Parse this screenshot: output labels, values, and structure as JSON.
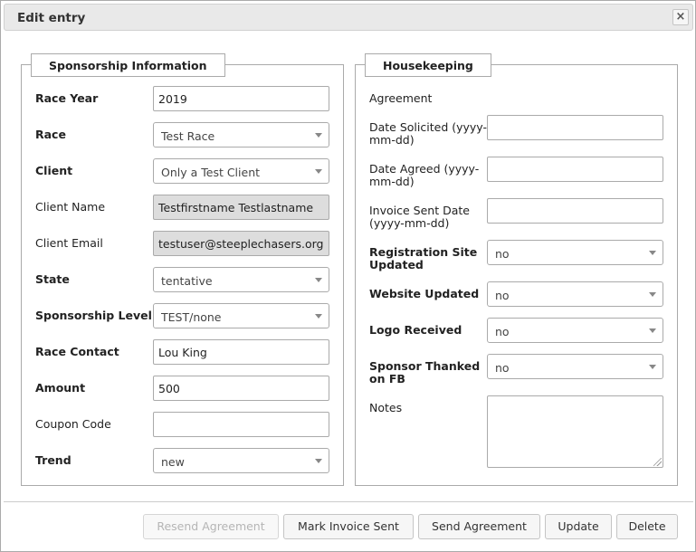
{
  "dialog": {
    "title": "Edit entry",
    "close_glyph": "×"
  },
  "sponsorship": {
    "legend": "Sponsorship Information",
    "race_year": {
      "label": "Race Year",
      "value": "2019"
    },
    "race": {
      "label": "Race",
      "value": "Test Race"
    },
    "client": {
      "label": "Client",
      "value": "Only a Test Client"
    },
    "client_name": {
      "label": "Client Name",
      "value": "Testfirstname Testlastname"
    },
    "client_email": {
      "label": "Client Email",
      "value": "testuser@steeplechasers.org"
    },
    "state": {
      "label": "State",
      "value": "tentative"
    },
    "sponsorship_level": {
      "label": "Sponsorship Level",
      "value": "TEST/none"
    },
    "race_contact": {
      "label": "Race Contact",
      "value": "Lou King"
    },
    "amount": {
      "label": "Amount",
      "value": "500"
    },
    "coupon_code": {
      "label": "Coupon Code",
      "value": ""
    },
    "trend": {
      "label": "Trend",
      "value": "new"
    }
  },
  "housekeeping": {
    "legend": "Housekeeping",
    "agreement_label": "Agreement",
    "date_solicited": {
      "label_1": "Date Solicited (yyyy-",
      "label_2": "mm-dd)",
      "value": ""
    },
    "date_agreed": {
      "label_1": "Date Agreed (yyyy-",
      "label_2": "mm-dd)",
      "value": ""
    },
    "invoice_sent_date": {
      "label_1": "Invoice Sent Date",
      "label_2": "(yyyy-mm-dd)",
      "value": ""
    },
    "registration_site_updated": {
      "label_1": "Registration Site",
      "label_2": "Updated",
      "value": "no"
    },
    "website_updated": {
      "label": "Website Updated",
      "value": "no"
    },
    "logo_received": {
      "label": "Logo Received",
      "value": "no"
    },
    "sponsor_thanked_on_fb": {
      "label_1": "Sponsor Thanked",
      "label_2": "on FB",
      "value": "no"
    },
    "notes": {
      "label": "Notes",
      "value": ""
    }
  },
  "buttons": {
    "resend_agreement": "Resend Agreement",
    "mark_invoice_sent": "Mark Invoice Sent",
    "send_agreement": "Send Agreement",
    "update": "Update",
    "delete": "Delete"
  },
  "colors": {
    "readonly_bg": "#dddddd",
    "titlebar_bg": "#e9e9e9",
    "border": "#aaaaaa"
  }
}
